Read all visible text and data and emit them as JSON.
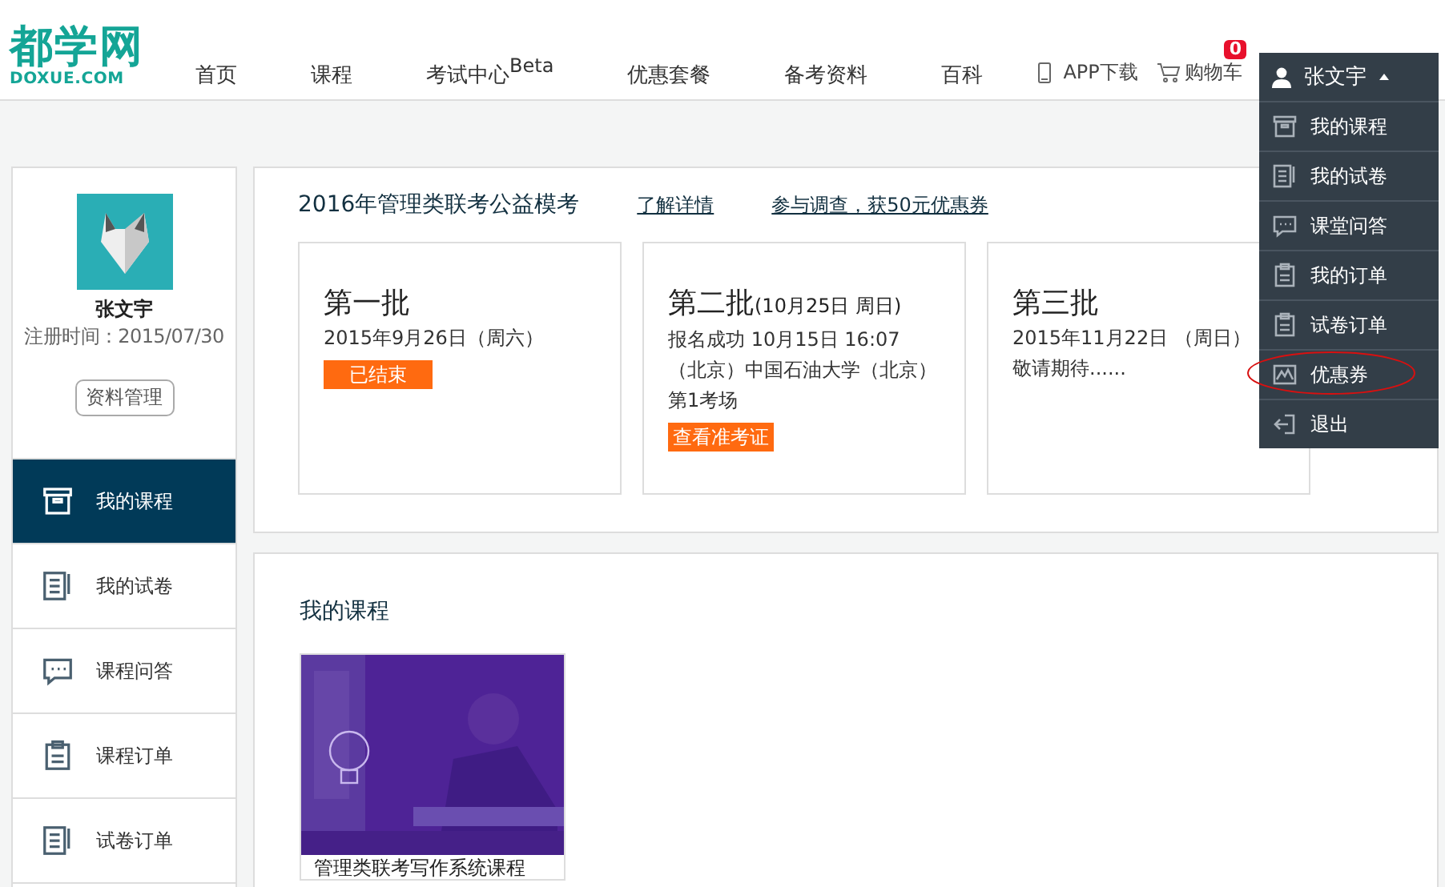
{
  "header": {
    "logo": {
      "title": "都学网",
      "subtitle": "DOXUE.COM"
    },
    "nav": [
      {
        "label": "首页"
      },
      {
        "label": "课程"
      },
      {
        "label": "考试中心",
        "sup": "Beta"
      },
      {
        "label": "优惠套餐"
      },
      {
        "label": "备考资料"
      },
      {
        "label": "百科"
      }
    ],
    "app_download": "APP下载",
    "cart": {
      "label": "购物车",
      "badge": "0"
    }
  },
  "user_menu": {
    "name": "张文宇",
    "expanded": true,
    "items": [
      {
        "label": "我的课程",
        "circled": false
      },
      {
        "label": "我的试卷",
        "circled": false
      },
      {
        "label": "课堂问答",
        "circled": false
      },
      {
        "label": "我的订单",
        "circled": false
      },
      {
        "label": "试卷订单",
        "circled": false
      },
      {
        "label": "优惠券",
        "circled": true
      },
      {
        "label": "退出",
        "circled": false
      }
    ]
  },
  "sidebar": {
    "profile": {
      "name": "张文宇",
      "registered": "注册时间：2015/07/30",
      "manage_button": "资料管理"
    },
    "items": [
      {
        "label": "我的课程",
        "selected": true
      },
      {
        "label": "我的试卷",
        "selected": false
      },
      {
        "label": "课程问答",
        "selected": false
      },
      {
        "label": "课程订单",
        "selected": false
      },
      {
        "label": "试卷订单",
        "selected": false
      }
    ]
  },
  "exam_panel": {
    "title": "2016年管理类联考公益模考",
    "links": [
      "了解详情",
      "参与调查，获50元优惠券"
    ],
    "batches": [
      {
        "title": "第一批",
        "lines": [
          "2015年9月26日（周六）"
        ],
        "action": {
          "kind": "status",
          "label": "已结束"
        }
      },
      {
        "title": "第二批",
        "subtitle": "(10月25日 周日)",
        "lines": [
          "报名成功 10月15日 16:07",
          "（北京）中国石油大学（北京）",
          "第1考场"
        ],
        "action": {
          "kind": "button",
          "label": "查看准考证"
        }
      },
      {
        "title": "第三批",
        "lines": [
          "2015年11月22日 （周日）",
          "敬请期待......"
        ]
      }
    ]
  },
  "courses": {
    "title": "我的课程",
    "items": [
      {
        "kind": "picture",
        "title": "管理类联考写作系统课程"
      }
    ]
  }
}
